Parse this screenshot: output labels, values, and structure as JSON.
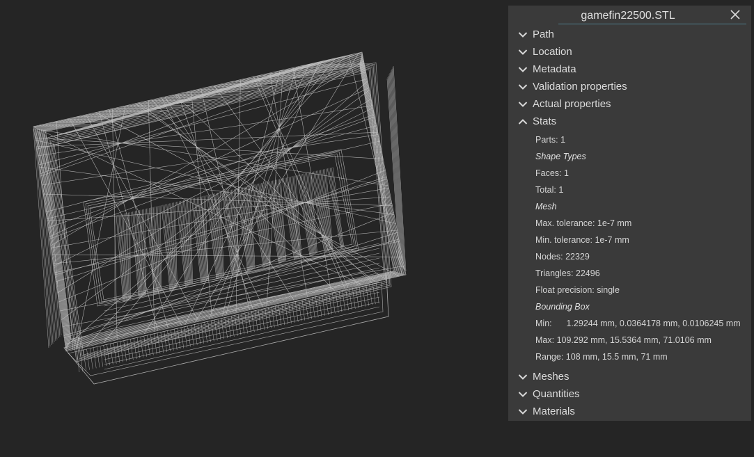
{
  "panel": {
    "title": "gamefin22500.STL",
    "sections_top": [
      {
        "label": "Path"
      },
      {
        "label": "Location"
      },
      {
        "label": "Metadata"
      },
      {
        "label": "Validation properties"
      },
      {
        "label": "Actual properties"
      }
    ],
    "stats": {
      "label": "Stats",
      "parts": "Parts: 1",
      "shape_types": "Shape Types",
      "faces": "Faces: 1",
      "total": "Total: 1",
      "mesh": "Mesh",
      "max_tolerance": "Max. tolerance: 1e-7 mm",
      "min_tolerance": "Min. tolerance: 1e-7 mm",
      "nodes": "Nodes: 22329",
      "triangles": "Triangles: 22496",
      "float_precision": "Float precision: single",
      "bounding_box": "Bounding Box",
      "min_label": "Min:",
      "min_value": "1.29244 mm, 0.0364178 mm, 0.0106245 mm",
      "max_label": "Max:",
      "max_value": "109.292 mm, 15.5364 mm, 71.0106 mm",
      "range_label": "Range:",
      "range_value": "108 mm, 15.5 mm, 71 mm"
    },
    "sections_bottom": [
      {
        "label": "Meshes"
      },
      {
        "label": "Quantities"
      },
      {
        "label": "Materials"
      }
    ]
  },
  "icons": {
    "close": "close-icon",
    "collapsed": "chevron-down-icon",
    "expanded": "chevron-up-icon"
  },
  "colors": {
    "background": "#252525",
    "panel": "#3a3a3a",
    "wireframe": "#c8c8c8",
    "accent_line": "#4f7f8f"
  }
}
